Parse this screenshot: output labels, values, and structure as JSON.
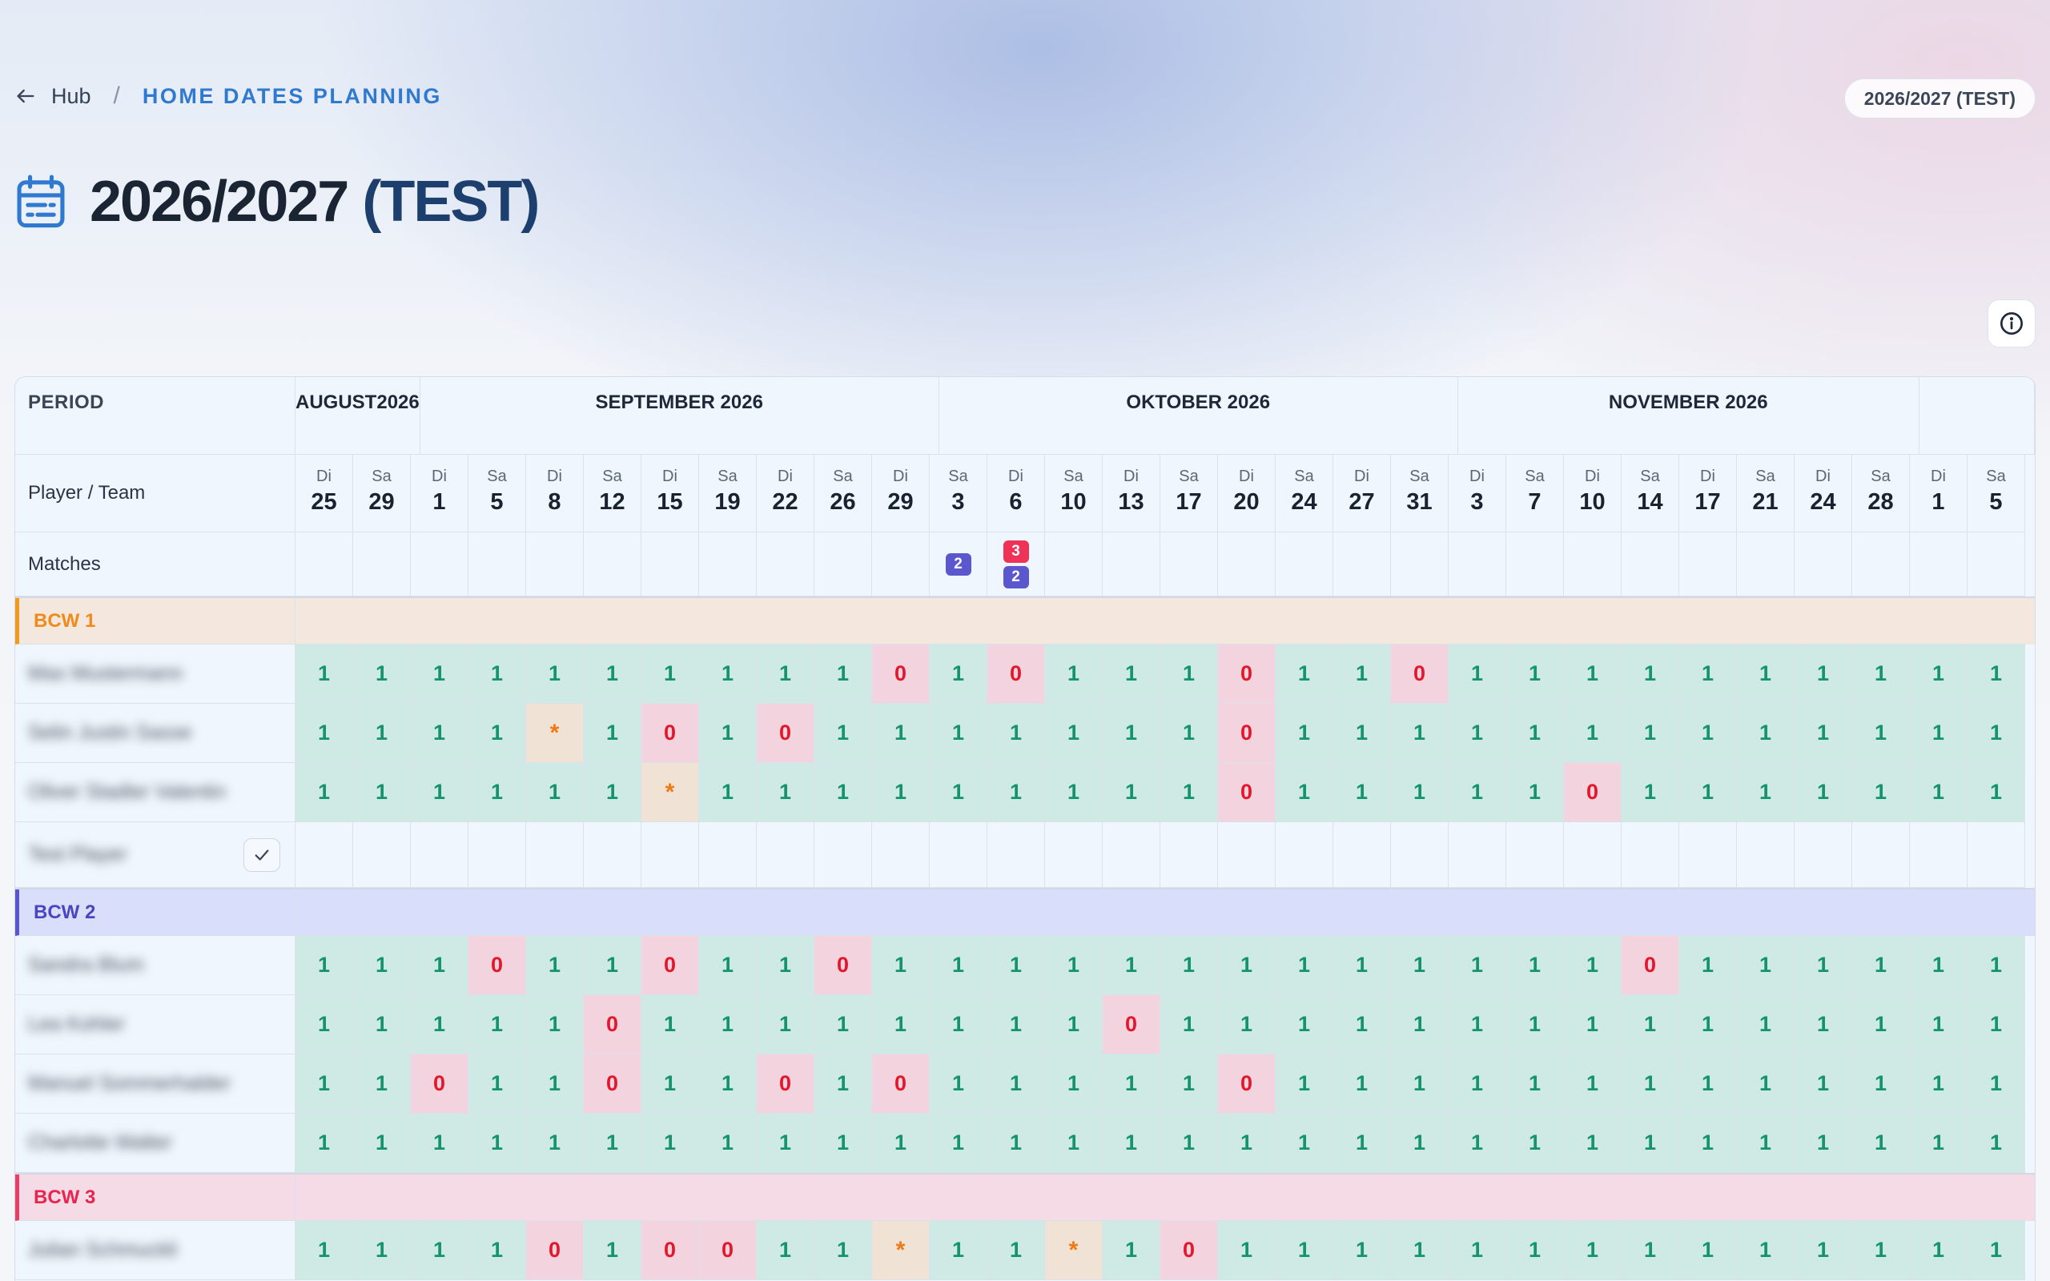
{
  "breadcrumb": {
    "back_label": "Hub",
    "separator": "/",
    "current": "HOME DATES PLANNING"
  },
  "season_pill": "2026/2027 (TEST)",
  "title": {
    "main": "2026/2027",
    "suffix": "(TEST)"
  },
  "icons": {
    "back": "arrow-left-icon",
    "title": "calendar-icon",
    "info": "info-icon",
    "confirm": "check-icon"
  },
  "colors": {
    "accent": "#2f7ad0",
    "available_bg": "#cfe9e5",
    "available_text": "#13946a",
    "unavailable_bg": "#f3d3dd",
    "unavailable_text": "#e4162b",
    "maybe_bg": "#f1e2d6",
    "maybe_text": "#ef7a14",
    "badge_red": "#ef3358",
    "badge_purple": "#5b57cf"
  },
  "grid": {
    "period_label": "PERIOD",
    "player_team_label": "Player / Team",
    "matches_label": "Matches",
    "months": [
      {
        "line1": "AUGUST",
        "line2": "2026",
        "span": 2
      },
      {
        "line1": "SEPTEMBER 2026",
        "line2": "",
        "span": 9
      },
      {
        "line1": "OKTOBER 2026",
        "line2": "",
        "span": 9
      },
      {
        "line1": "NOVEMBER 2026",
        "line2": "",
        "span": 8
      },
      {
        "line1": "",
        "line2": "",
        "span": 2
      }
    ],
    "dates": [
      {
        "dow": "Di",
        "d": "25"
      },
      {
        "dow": "Sa",
        "d": "29"
      },
      {
        "dow": "Di",
        "d": "1"
      },
      {
        "dow": "Sa",
        "d": "5"
      },
      {
        "dow": "Di",
        "d": "8"
      },
      {
        "dow": "Sa",
        "d": "12"
      },
      {
        "dow": "Di",
        "d": "15"
      },
      {
        "dow": "Sa",
        "d": "19"
      },
      {
        "dow": "Di",
        "d": "22"
      },
      {
        "dow": "Sa",
        "d": "26"
      },
      {
        "dow": "Di",
        "d": "29"
      },
      {
        "dow": "Sa",
        "d": "3"
      },
      {
        "dow": "Di",
        "d": "6"
      },
      {
        "dow": "Sa",
        "d": "10"
      },
      {
        "dow": "Di",
        "d": "13"
      },
      {
        "dow": "Sa",
        "d": "17"
      },
      {
        "dow": "Di",
        "d": "20"
      },
      {
        "dow": "Sa",
        "d": "24"
      },
      {
        "dow": "Di",
        "d": "27"
      },
      {
        "dow": "Sa",
        "d": "31"
      },
      {
        "dow": "Di",
        "d": "3"
      },
      {
        "dow": "Sa",
        "d": "7"
      },
      {
        "dow": "Di",
        "d": "10"
      },
      {
        "dow": "Sa",
        "d": "14"
      },
      {
        "dow": "Di",
        "d": "17"
      },
      {
        "dow": "Sa",
        "d": "21"
      },
      {
        "dow": "Di",
        "d": "24"
      },
      {
        "dow": "Sa",
        "d": "28"
      },
      {
        "dow": "Di",
        "d": "1"
      },
      {
        "dow": "Sa",
        "d": "5"
      }
    ],
    "matches": {
      "11": [
        {
          "n": "2",
          "color": "purple"
        }
      ],
      "12": [
        {
          "n": "3",
          "color": "red"
        },
        {
          "n": "2",
          "color": "purple"
        }
      ]
    },
    "teams": [
      {
        "name": "BCW 1",
        "accent": "#f29a1c",
        "bg": "#f3e7de",
        "text": "#f08a1a",
        "players": [
          {
            "name": "Max Mustermann",
            "values": [
              "1",
              "1",
              "1",
              "1",
              "1",
              "1",
              "1",
              "1",
              "1",
              "1",
              "0",
              "1",
              "0",
              "1",
              "1",
              "1",
              "0",
              "1",
              "1",
              "0",
              "1",
              "1",
              "1",
              "1",
              "1",
              "1",
              "1",
              "1",
              "1",
              "1"
            ]
          },
          {
            "name": "Selin Justin Sasse",
            "values": [
              "1",
              "1",
              "1",
              "1",
              "*",
              "1",
              "0",
              "1",
              "0",
              "1",
              "1",
              "1",
              "1",
              "1",
              "1",
              "1",
              "0",
              "1",
              "1",
              "1",
              "1",
              "1",
              "1",
              "1",
              "1",
              "1",
              "1",
              "1",
              "1",
              "1"
            ]
          },
          {
            "name": "Oliver Stadler Valentin",
            "values": [
              "1",
              "1",
              "1",
              "1",
              "1",
              "1",
              "*",
              "1",
              "1",
              "1",
              "1",
              "1",
              "1",
              "1",
              "1",
              "1",
              "0",
              "1",
              "1",
              "1",
              "1",
              "1",
              "0",
              "1",
              "1",
              "1",
              "1",
              "1",
              "1",
              "1"
            ]
          },
          {
            "name": "Test Player",
            "confirm": true,
            "values": [
              "",
              "",
              "",
              "",
              "",
              "",
              "",
              "",
              "",
              "",
              "",
              "",
              "",
              "",
              "",
              "",
              "",
              "",
              "",
              "",
              "",
              "",
              "",
              "",
              "",
              "",
              "",
              "",
              "",
              ""
            ]
          }
        ]
      },
      {
        "name": "BCW 2",
        "accent": "#5a55d0",
        "bg": "#d9defa",
        "text": "#4a46c0",
        "players": [
          {
            "name": "Sandra Blum",
            "values": [
              "1",
              "1",
              "1",
              "0",
              "1",
              "1",
              "0",
              "1",
              "1",
              "0",
              "1",
              "1",
              "1",
              "1",
              "1",
              "1",
              "1",
              "1",
              "1",
              "1",
              "1",
              "1",
              "1",
              "0",
              "1",
              "1",
              "1",
              "1",
              "1",
              "1"
            ]
          },
          {
            "name": "Lea Kohler",
            "values": [
              "1",
              "1",
              "1",
              "1",
              "1",
              "0",
              "1",
              "1",
              "1",
              "1",
              "1",
              "1",
              "1",
              "1",
              "0",
              "1",
              "1",
              "1",
              "1",
              "1",
              "1",
              "1",
              "1",
              "1",
              "1",
              "1",
              "1",
              "1",
              "1",
              "1"
            ]
          },
          {
            "name": "Manuel Sommerhalder",
            "values": [
              "1",
              "1",
              "0",
              "1",
              "1",
              "0",
              "1",
              "1",
              "0",
              "1",
              "0",
              "1",
              "1",
              "1",
              "1",
              "1",
              "0",
              "1",
              "1",
              "1",
              "1",
              "1",
              "1",
              "1",
              "1",
              "1",
              "1",
              "1",
              "1",
              "1"
            ]
          },
          {
            "name": "Charlotte Walter",
            "values": [
              "1",
              "1",
              "1",
              "1",
              "1",
              "1",
              "1",
              "1",
              "1",
              "1",
              "1",
              "1",
              "1",
              "1",
              "1",
              "1",
              "1",
              "1",
              "1",
              "1",
              "1",
              "1",
              "1",
              "1",
              "1",
              "1",
              "1",
              "1",
              "1",
              "1"
            ]
          }
        ]
      },
      {
        "name": "BCW 3",
        "accent": "#ec3d66",
        "bg": "#f4dbe6",
        "text": "#e8244f",
        "players": [
          {
            "name": "Julian Schmuckli",
            "values": [
              "1",
              "1",
              "1",
              "1",
              "0",
              "1",
              "0",
              "0",
              "1",
              "1",
              "*",
              "1",
              "1",
              "*",
              "1",
              "0",
              "1",
              "1",
              "1",
              "1",
              "1",
              "1",
              "1",
              "1",
              "1",
              "1",
              "1",
              "1",
              "1",
              "1"
            ]
          }
        ]
      }
    ]
  }
}
